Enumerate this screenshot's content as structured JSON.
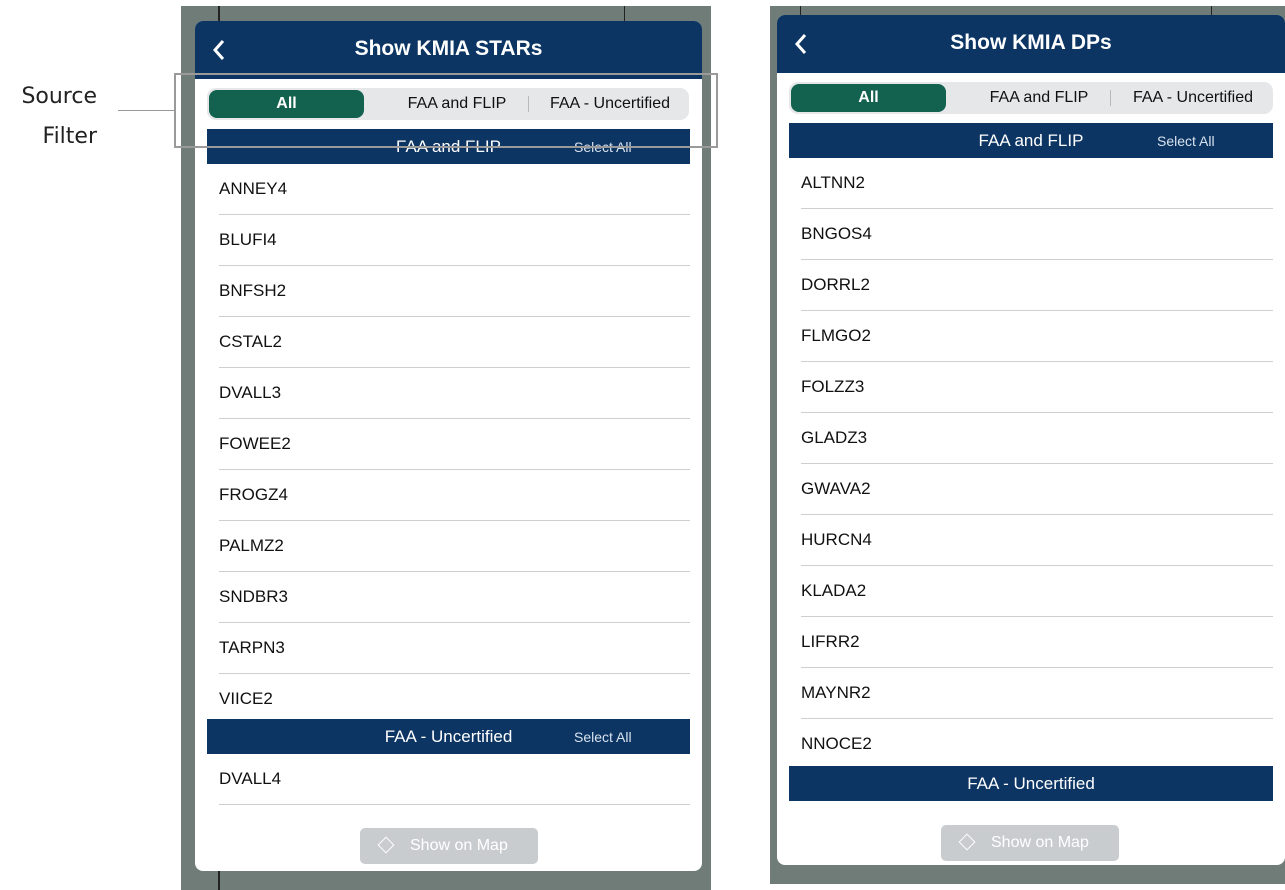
{
  "callout": {
    "line1": "Source",
    "line2": "Filter"
  },
  "stars_panel": {
    "title": "Show KMIA STARs",
    "filters": [
      "All",
      "FAA and FLIP",
      "FAA - Uncertified"
    ],
    "sections": [
      {
        "title": "FAA and FLIP",
        "select_all": "Select All",
        "items": [
          "ANNEY4",
          "BLUFI4",
          "BNFSH2",
          "CSTAL2",
          "DVALL3",
          "FOWEE2",
          "FROGZ4",
          "PALMZ2",
          "SNDBR3",
          "TARPN3",
          "VIICE2"
        ]
      },
      {
        "title": "FAA - Uncertified",
        "select_all": "Select All",
        "items": [
          "DVALL4"
        ]
      }
    ],
    "map_button": "Show on Map"
  },
  "dps_panel": {
    "title": "Show KMIA DPs",
    "filters": [
      "All",
      "FAA and FLIP",
      "FAA - Uncertified"
    ],
    "sections": [
      {
        "title": "FAA and FLIP",
        "select_all": "Select All",
        "items": [
          "ALTNN2",
          "BNGOS4",
          "DORRL2",
          "FLMGO2",
          "FOLZZ3",
          "GLADZ3",
          "GWAVA2",
          "HURCN4",
          "KLADA2",
          "LIFRR2",
          "MAYNR2",
          "NNOCE2"
        ]
      },
      {
        "title": "FAA - Uncertified"
      }
    ],
    "map_button": "Show on Map"
  },
  "colors": {
    "header": "#0c3563",
    "active_filter": "#13614f"
  }
}
